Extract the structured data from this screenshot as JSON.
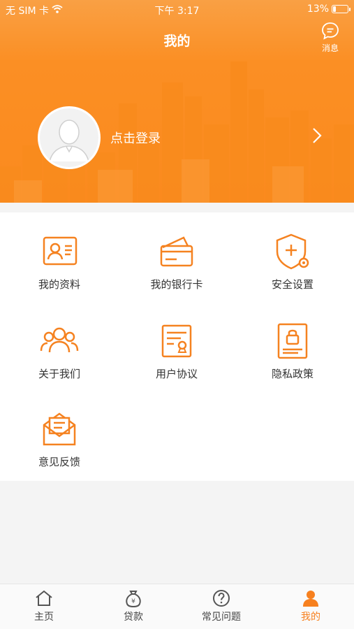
{
  "status_bar": {
    "carrier": "无 SIM 卡",
    "time": "下午 3:17",
    "battery": "13%"
  },
  "header": {
    "title": "我的",
    "message_label": "消息"
  },
  "profile": {
    "login_text": "点击登录"
  },
  "menu": [
    {
      "label": "我的资料",
      "icon": "id-card-icon"
    },
    {
      "label": "我的银行卡",
      "icon": "bank-card-icon"
    },
    {
      "label": "安全设置",
      "icon": "shield-settings-icon"
    },
    {
      "label": "关于我们",
      "icon": "users-icon"
    },
    {
      "label": "用户协议",
      "icon": "agreement-icon"
    },
    {
      "label": "隐私政策",
      "icon": "privacy-lock-icon"
    },
    {
      "label": "意见反馈",
      "icon": "feedback-envelope-icon"
    }
  ],
  "tabs": [
    {
      "label": "主页",
      "icon": "home-icon",
      "active": false
    },
    {
      "label": "贷款",
      "icon": "money-bag-icon",
      "active": false
    },
    {
      "label": "常见问题",
      "icon": "question-icon",
      "active": false
    },
    {
      "label": "我的",
      "icon": "person-icon",
      "active": true
    }
  ],
  "colors": {
    "accent": "#f7801e",
    "header_top": "#f9a044",
    "header_bottom": "#fb8f24"
  }
}
